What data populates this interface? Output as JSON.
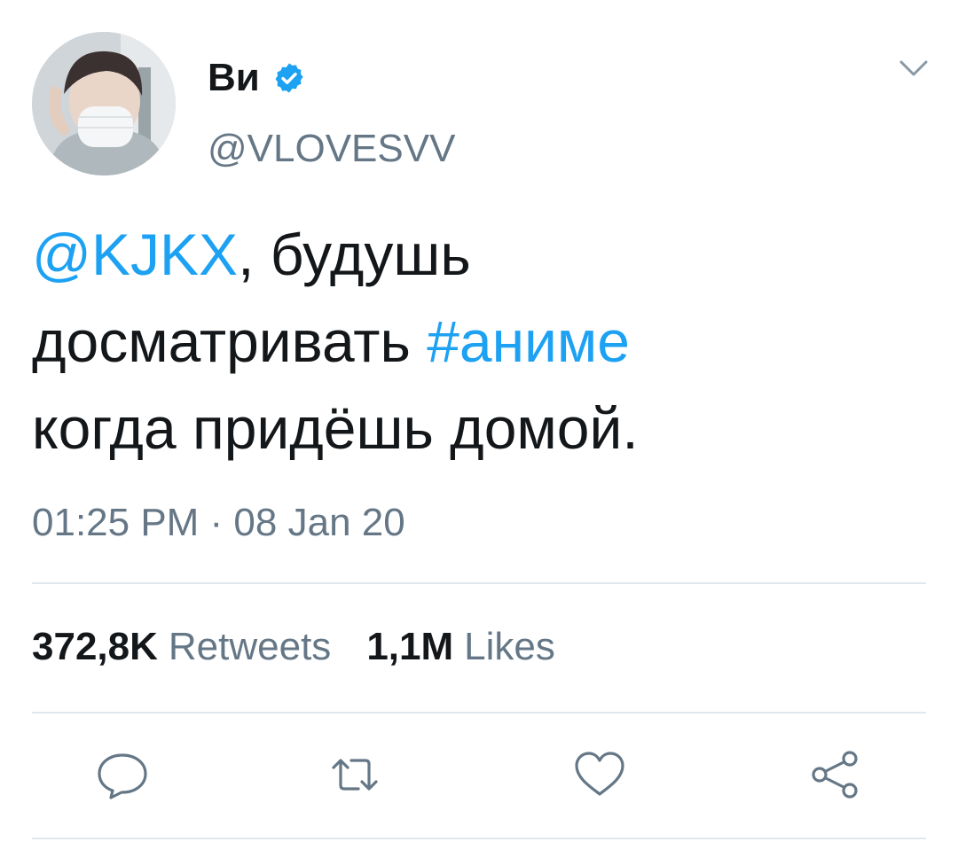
{
  "user": {
    "display_name": "Ви",
    "handle": "@VLOVESVV",
    "verified": true,
    "avatar": "profile-photo"
  },
  "tweet": {
    "mention": "@KJKX",
    "text_part1": ", будушь",
    "text_part2": "досматривать ",
    "hashtag": "#аниме",
    "text_part3": "когда придёшь домой.",
    "timestamp": "01:25 PM · 08 Jan 20"
  },
  "stats": {
    "retweets_count": "372,8K",
    "retweets_label": "Retweets",
    "likes_count": "1,1M",
    "likes_label": "Likes"
  },
  "actions": {
    "reply_icon": "reply-icon",
    "retweet_icon": "retweet-icon",
    "like_icon": "heart-icon",
    "share_icon": "share-icon",
    "menu_icon": "chevron-down-icon"
  },
  "colors": {
    "accent": "#1da1f2",
    "text": "#14171a",
    "secondary": "#657786",
    "divider": "#e1e8ed"
  }
}
